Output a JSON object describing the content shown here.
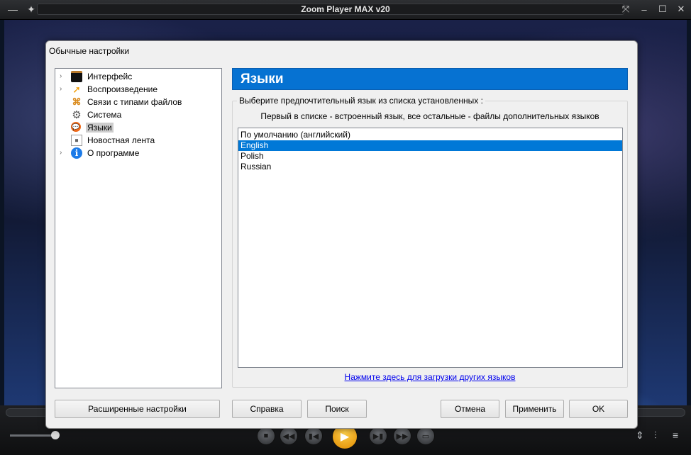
{
  "window": {
    "title": "Zoom Player MAX v20"
  },
  "dialog": {
    "title": "Обычные настройки",
    "tree": [
      {
        "label": "Интерфейс",
        "icon": "interface-icon",
        "expandable": true
      },
      {
        "label": "Воспроизведение",
        "icon": "playback-icon",
        "expandable": true
      },
      {
        "label": "Связи с типами файлов",
        "icon": "file-association-icon",
        "expandable": false
      },
      {
        "label": "Система",
        "icon": "gear-icon",
        "expandable": false
      },
      {
        "label": "Языки",
        "icon": "language-icon",
        "expandable": false,
        "selected": true
      },
      {
        "label": "Новостная лента",
        "icon": "news-icon",
        "expandable": false
      },
      {
        "label": "О программе",
        "icon": "info-icon",
        "expandable": true
      }
    ],
    "panel": {
      "header": "Языки",
      "group_label": "Выберите предпочтительный язык из списка установленных :",
      "hint": "Первый в списке - встроенный язык, все остальные - файлы дополнительных языков",
      "languages": [
        "По умолчанию (английский)",
        "English",
        "Polish",
        "Russian"
      ],
      "selected_language": "English",
      "download_link": "Нажмите здесь для загрузки других языков"
    },
    "buttons": {
      "advanced": "Расширенные настройки",
      "help": "Справка",
      "search": "Поиск",
      "cancel": "Отмена",
      "apply": "Применить",
      "ok": "OK"
    }
  },
  "colors": {
    "header_blue": "#0672d2",
    "selection_blue": "#0078d7",
    "play_button": "#f0a000"
  }
}
